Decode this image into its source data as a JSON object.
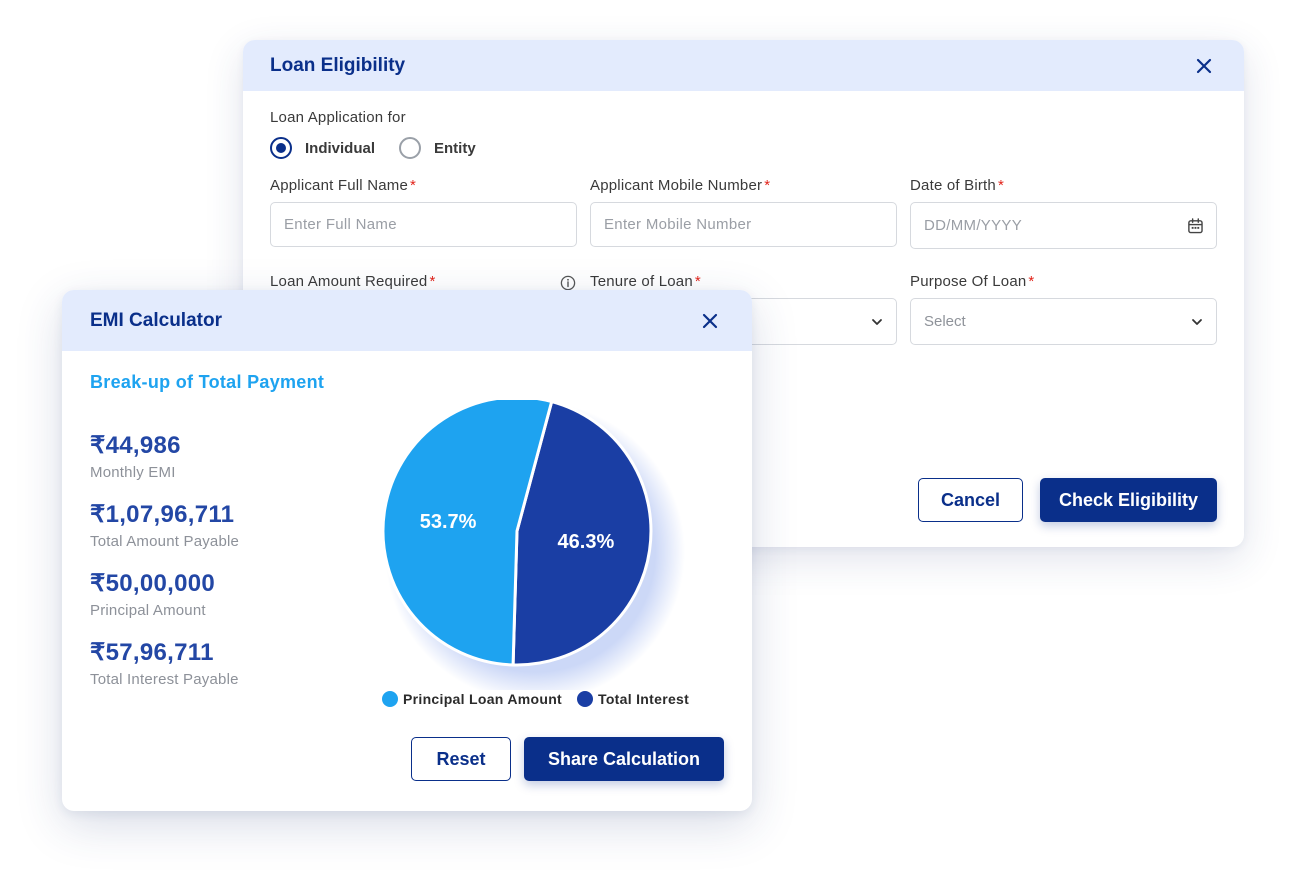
{
  "colors": {
    "brand_navy": "#0a2f8a",
    "header_bg": "#e3ebfd",
    "accent_blue": "#1ea3f0",
    "required": "#e2231a",
    "principal_slice": "#1ea3f0",
    "interest_slice": "#1a3ea4"
  },
  "loan_dialog": {
    "title": "Loan Eligibility",
    "close_icon": "close-icon",
    "application_for_label": "Loan Application for",
    "application_options": [
      {
        "label": "Individual",
        "selected": true
      },
      {
        "label": "Entity",
        "selected": false
      }
    ],
    "full_name": {
      "label": "Applicant Full Name",
      "required_mark": "*",
      "placeholder": "Enter Full Name",
      "value": ""
    },
    "mobile": {
      "label": "Applicant Mobile Number",
      "required_mark": "*",
      "placeholder": "Enter Mobile Number",
      "value": ""
    },
    "dob": {
      "label": "Date of Birth",
      "required_mark": "*",
      "placeholder": "DD/MM/YYYY",
      "value": "",
      "icon": "calendar-icon"
    },
    "loan_amount": {
      "label": "Loan Amount Required",
      "required_mark": "*",
      "icon": "info-icon"
    },
    "tenure": {
      "label": "Tenure of Loan",
      "required_mark": "*",
      "icon": "chevron-down-icon"
    },
    "purpose": {
      "label": "Purpose Of Loan",
      "required_mark": "*",
      "selected": "Select",
      "icon": "chevron-down-icon"
    },
    "cancel_label": "Cancel",
    "check_label": "Check Eligibility"
  },
  "emi_dialog": {
    "title": "EMI Calculator",
    "close_icon": "close-icon",
    "breakup_title": "Break-up of Total Payment",
    "stats": [
      {
        "value": "₹44,986",
        "label": "Monthly EMI"
      },
      {
        "value": "₹1,07,96,711",
        "label": "Total Amount Payable"
      },
      {
        "value": "₹50,00,000",
        "label": "Principal Amount"
      },
      {
        "value": "₹57,96,711",
        "label": "Total Interest Payable"
      }
    ],
    "reset_label": "Reset",
    "share_label": "Share Calculation"
  },
  "chart_data": {
    "type": "pie",
    "categories": [
      "Principal Loan Amount",
      "Total Interest"
    ],
    "values": [
      53.7,
      46.3
    ],
    "data_labels": [
      "53.7%",
      "46.3%"
    ],
    "colors": [
      "#1ea3f0",
      "#1a3ea4"
    ],
    "legend_position": "bottom"
  }
}
